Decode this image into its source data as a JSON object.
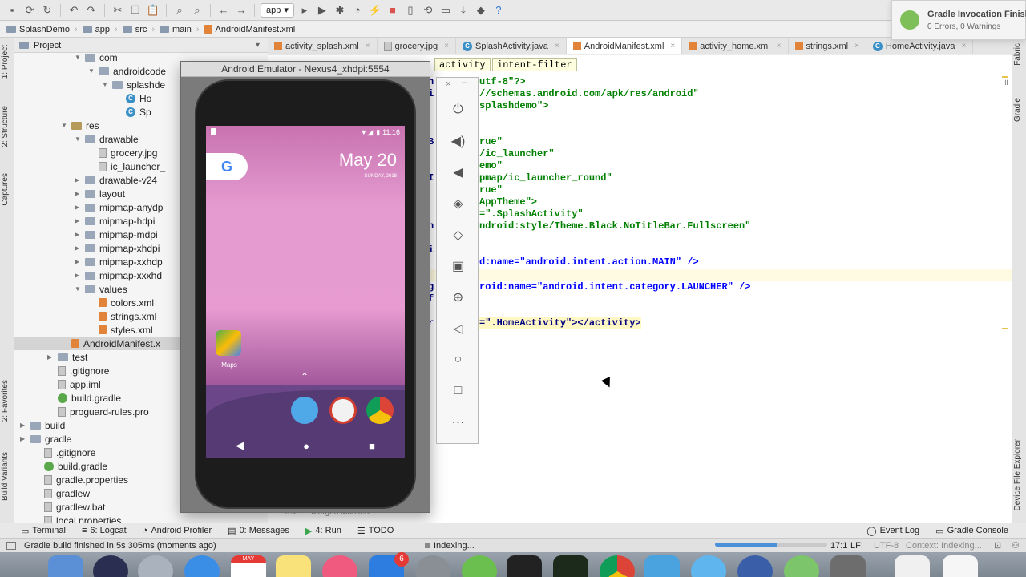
{
  "toolbar": {
    "run_config": "app",
    "icons": [
      "save-icon",
      "sync-icon",
      "refresh-icon",
      "undo-icon",
      "redo-icon",
      "cut-icon",
      "copy-icon",
      "paste-icon",
      "find-icon",
      "replace-icon",
      "back-icon",
      "forward-icon",
      "build-icon",
      "run-icon",
      "debug-icon",
      "profile-icon",
      "apply-changes-icon",
      "stop-icon",
      "avd-manager-icon",
      "sync-gradle-icon",
      "project-structure-icon",
      "sdk-manager-icon",
      "layout-inspector-icon",
      "help-icon"
    ]
  },
  "breadcrumb": [
    "SplashDemo",
    "app",
    "src",
    "main",
    "AndroidManifest.xml"
  ],
  "left_tabs": [
    "1: Project",
    "2: Structure",
    "Captures",
    "2: Favorites",
    "Build Variants"
  ],
  "right_tabs": [
    "Fabric",
    "Gradle",
    "Device File Explorer"
  ],
  "project_panel": {
    "title": "Project",
    "rows": [
      {
        "label": "com",
        "indent": 5,
        "type": "folder",
        "tri": "▼"
      },
      {
        "label": "androidcode",
        "indent": 6,
        "type": "folder",
        "tri": "▼"
      },
      {
        "label": "splashde",
        "indent": 7,
        "type": "folder",
        "tri": "▼"
      },
      {
        "label": "Ho",
        "indent": 8,
        "type": "class",
        "tri": ""
      },
      {
        "label": "Sp",
        "indent": 8,
        "type": "class",
        "tri": ""
      },
      {
        "label": "res",
        "indent": 4,
        "type": "resfolder",
        "tri": "▼"
      },
      {
        "label": "drawable",
        "indent": 5,
        "type": "folder",
        "tri": "▼"
      },
      {
        "label": "grocery.jpg",
        "indent": 6,
        "type": "file",
        "tri": ""
      },
      {
        "label": "ic_launcher_",
        "indent": 6,
        "type": "file",
        "tri": ""
      },
      {
        "label": "drawable-v24",
        "indent": 5,
        "type": "folder",
        "tri": "▶"
      },
      {
        "label": "layout",
        "indent": 5,
        "type": "folder",
        "tri": "▶"
      },
      {
        "label": "mipmap-anydp",
        "indent": 5,
        "type": "folder",
        "tri": "▶"
      },
      {
        "label": "mipmap-hdpi",
        "indent": 5,
        "type": "folder",
        "tri": "▶"
      },
      {
        "label": "mipmap-mdpi",
        "indent": 5,
        "type": "folder",
        "tri": "▶"
      },
      {
        "label": "mipmap-xhdpi",
        "indent": 5,
        "type": "folder",
        "tri": "▶"
      },
      {
        "label": "mipmap-xxhdp",
        "indent": 5,
        "type": "folder",
        "tri": "▶"
      },
      {
        "label": "mipmap-xxxhd",
        "indent": 5,
        "type": "folder",
        "tri": "▶"
      },
      {
        "label": "values",
        "indent": 5,
        "type": "folder",
        "tri": "▼"
      },
      {
        "label": "colors.xml",
        "indent": 6,
        "type": "xml",
        "tri": ""
      },
      {
        "label": "strings.xml",
        "indent": 6,
        "type": "xml",
        "tri": ""
      },
      {
        "label": "styles.xml",
        "indent": 6,
        "type": "xml",
        "tri": ""
      },
      {
        "label": "AndroidManifest.x",
        "indent": 4,
        "type": "xml",
        "tri": "",
        "selected": true
      },
      {
        "label": "test",
        "indent": 3,
        "type": "folder",
        "tri": "▶"
      },
      {
        "label": ".gitignore",
        "indent": 3,
        "type": "file",
        "tri": ""
      },
      {
        "label": "app.iml",
        "indent": 3,
        "type": "file",
        "tri": ""
      },
      {
        "label": "build.gradle",
        "indent": 3,
        "type": "gradle",
        "tri": ""
      },
      {
        "label": "proguard-rules.pro",
        "indent": 3,
        "type": "file",
        "tri": ""
      },
      {
        "label": "build",
        "indent": 1,
        "type": "folder",
        "tri": "▶"
      },
      {
        "label": "gradle",
        "indent": 1,
        "type": "folder",
        "tri": "▶"
      },
      {
        "label": ".gitignore",
        "indent": 2,
        "type": "file",
        "tri": ""
      },
      {
        "label": "build.gradle",
        "indent": 2,
        "type": "gradle",
        "tri": ""
      },
      {
        "label": "gradle.properties",
        "indent": 2,
        "type": "file",
        "tri": ""
      },
      {
        "label": "gradlew",
        "indent": 2,
        "type": "file",
        "tri": ""
      },
      {
        "label": "gradlew.bat",
        "indent": 2,
        "type": "file",
        "tri": ""
      },
      {
        "label": "local.properties",
        "indent": 2,
        "type": "file",
        "tri": ""
      }
    ]
  },
  "editor_tabs": [
    {
      "label": "activity_splash.xml",
      "kind": "xml",
      "active": false
    },
    {
      "label": "grocery.jpg",
      "kind": "img",
      "active": false
    },
    {
      "label": "SplashActivity.java",
      "kind": "class",
      "active": false
    },
    {
      "label": "AndroidManifest.xml",
      "kind": "xml",
      "active": true
    },
    {
      "label": "activity_home.xml",
      "kind": "xml",
      "active": false
    },
    {
      "label": "strings.xml",
      "kind": "xml",
      "active": false
    },
    {
      "label": "HomeActivity.java",
      "kind": "class",
      "active": false
    }
  ],
  "editor": {
    "chips": [
      "activity",
      "intent-filter"
    ],
    "code": [
      {
        "gutter": "n",
        "text": "utf-8\"?>",
        "cls": "str"
      },
      {
        "gutter": "i",
        "text": "//schemas.android.com/apk/res/android\"",
        "cls": "str"
      },
      {
        "gutter": "",
        "text": "splashdemo\">",
        "cls": "str"
      },
      {
        "gutter": "",
        "text": "",
        "cls": "plain"
      },
      {
        "gutter": "B",
        "text": "rue\"",
        "cls": "str"
      },
      {
        "gutter": "",
        "text": "/ic_launcher\"",
        "cls": "str"
      },
      {
        "gutter": "",
        "text": "emo\"",
        "cls": "str"
      },
      {
        "gutter": "I",
        "text": "pmap/ic_launcher_round\"",
        "cls": "str"
      },
      {
        "gutter": "",
        "text": "rue\"",
        "cls": "str"
      },
      {
        "gutter": "",
        "text": "AppTheme\">",
        "cls": "str"
      },
      {
        "gutter": "",
        "text": "=\".SplashActivity\"",
        "cls": "str"
      },
      {
        "gutter": "h",
        "text": "ndroid:style/Theme.Black.NoTitleBar.Fullscreen\"",
        "cls": "str"
      },
      {
        "gutter": "",
        "text": "",
        "cls": "plain"
      },
      {
        "gutter": "i",
        "text": "",
        "cls": "plain"
      },
      {
        "gutter": "",
        "text": "d:name=\"android.intent.action.MAIN\" />",
        "cls": "mix1"
      },
      {
        "gutter": "",
        "text": "",
        "cls": "plain"
      },
      {
        "gutter": "g",
        "text": "roid:name=\"android.intent.category.LAUNCHER\" />",
        "cls": "mix2"
      },
      {
        "gutter": "f",
        "text": "",
        "cls": "plain"
      },
      {
        "gutter": "",
        "text": "",
        "cls": "plain"
      },
      {
        "gutter": "r",
        "text": "=\".HomeActivity\"></activity>",
        "cls": "mix3"
      }
    ],
    "bottom_tabs": [
      "Text",
      "Merged Manifest"
    ]
  },
  "emulator": {
    "title": "Android Emulator - Nexus4_xhdpi:5554",
    "time": "11:16",
    "date_big": "May 20",
    "date_small": "SUNDAY, 2018",
    "maps_label": "Maps",
    "google_letter": "G",
    "controls": [
      "power-icon",
      "volume-up-icon",
      "volume-down-icon",
      "rotate-left-icon",
      "rotate-right-icon",
      "screenshot-icon",
      "zoom-icon",
      "back-icon",
      "home-icon",
      "overview-icon",
      "more-icon"
    ]
  },
  "notification": {
    "title": "Gradle Invocation Finish",
    "subtitle": "0 Errors, 0 Warnings"
  },
  "bottom_tools": [
    {
      "label": "Terminal",
      "icon": "terminal-icon"
    },
    {
      "label": "6: Logcat",
      "icon": "logcat-icon"
    },
    {
      "label": "Android Profiler",
      "icon": "profiler-icon"
    },
    {
      "label": "0: Messages",
      "icon": "messages-icon"
    },
    {
      "label": "4: Run",
      "icon": "run-icon"
    },
    {
      "label": "TODO",
      "icon": "todo-icon"
    }
  ],
  "bottom_tools_right": [
    {
      "label": "Event Log",
      "icon": "event-log-icon"
    },
    {
      "label": "Gradle Console",
      "icon": "gradle-console-icon"
    }
  ],
  "status": {
    "message": "Gradle build finished in 5s 305ms (moments ago)",
    "indexing": "Indexing...",
    "position": "17:1",
    "line_sep": "LF:",
    "encoding": "UTF-8",
    "context": "Context: Indexing...",
    "indexing_progress": 0.55
  },
  "dock": {
    "calendar_month": "MAY",
    "badge": "6"
  },
  "colors": {
    "accent": "#4a90d9",
    "string_green": "#008000",
    "tag_navy": "#000080"
  }
}
